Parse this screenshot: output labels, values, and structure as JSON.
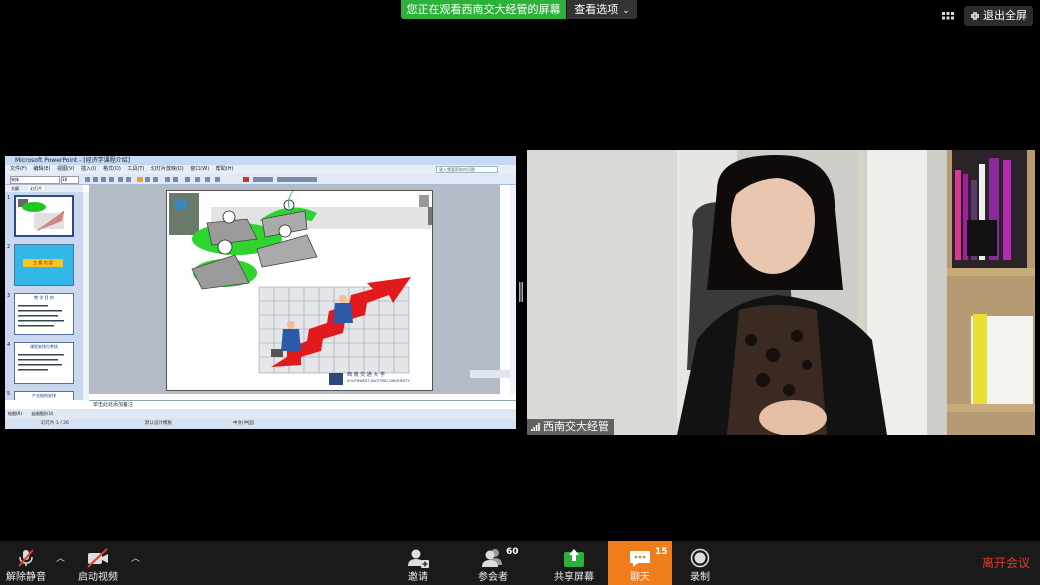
{
  "banner": {
    "viewing_text": "您正在观看西南交大经管的屏幕",
    "view_options": "查看选项"
  },
  "exit_fullscreen": "退出全屏",
  "ppt": {
    "window_title": "Microsoft PowerPoint - [经济学课程介绍]",
    "menu": [
      "文件(F)",
      "编辑(E)",
      "视图(V)",
      "插入(I)",
      "格式(O)",
      "工具(T)",
      "幻灯片放映(D)",
      "窗口(W)",
      "帮助(H)"
    ],
    "help_placeholder": "键入需要帮助的问题",
    "font": "宋体",
    "font_size": "18",
    "tabs": [
      "大纲",
      "幻灯片"
    ],
    "thumbnails": [
      {
        "num": "1",
        "title": ""
      },
      {
        "num": "2",
        "title": "主 要 内 容"
      },
      {
        "num": "3",
        "title": "教 学 目 的"
      },
      {
        "num": "4",
        "title": "课程安排与考核"
      },
      {
        "num": "5",
        "title": "产业结构安排"
      }
    ],
    "notes": "单击此处添加备注",
    "draw_label": "绘图(R)",
    "autoshape_label": "自选图形(U)",
    "status": {
      "slide": "幻灯片 1 / 26",
      "design": "默认设计模板",
      "language": "中文(中国)"
    },
    "slide_logo_cn": "西 南 交 通 大 学",
    "slide_logo_en": "SOUTHWEST JIAOTONG UNIVERSITY"
  },
  "video": {
    "participant_name": "西南交大经管"
  },
  "toolbar": {
    "unmute": "解除静音",
    "start_video": "启动视频",
    "invite": "邀请",
    "participants": "参会者",
    "participants_count": "60",
    "share": "共享屏幕",
    "chat": "聊天",
    "chat_count": "15",
    "record": "录制",
    "leave": "离开会议"
  },
  "colors": {
    "banner_green": "#2cb13a",
    "chat_orange": "#ef7d1b",
    "leave_red": "#e23a2e",
    "share_green": "#2cb13a"
  }
}
